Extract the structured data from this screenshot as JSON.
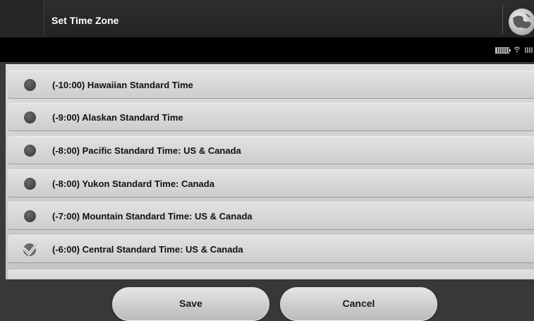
{
  "window": {
    "title": "Set Time Zone",
    "globe_icon": "globe-icon"
  },
  "status": {
    "icons": [
      "battery-icon",
      "wifi-icon",
      "signal-icon"
    ]
  },
  "timezones": [
    {
      "label": "(-10:00) Hawaiian Standard Time",
      "selected": false
    },
    {
      "label": "(-9:00) Alaskan Standard Time",
      "selected": false
    },
    {
      "label": "(-8:00) Pacific Standard Time: US & Canada",
      "selected": false
    },
    {
      "label": "(-8:00) Yukon Standard Time: Canada",
      "selected": false
    },
    {
      "label": "(-7:00) Mountain Standard Time: US & Canada",
      "selected": false
    },
    {
      "label": "(-6:00) Central Standard Time: US & Canada",
      "selected": true
    }
  ],
  "buttons": {
    "save_label": "Save",
    "cancel_label": "Cancel"
  },
  "colors": {
    "title_bg": "#2a2a2a",
    "status_bg": "#000000",
    "row_bg": "#d8d8d8",
    "button_bg": "#d0d0d0"
  }
}
